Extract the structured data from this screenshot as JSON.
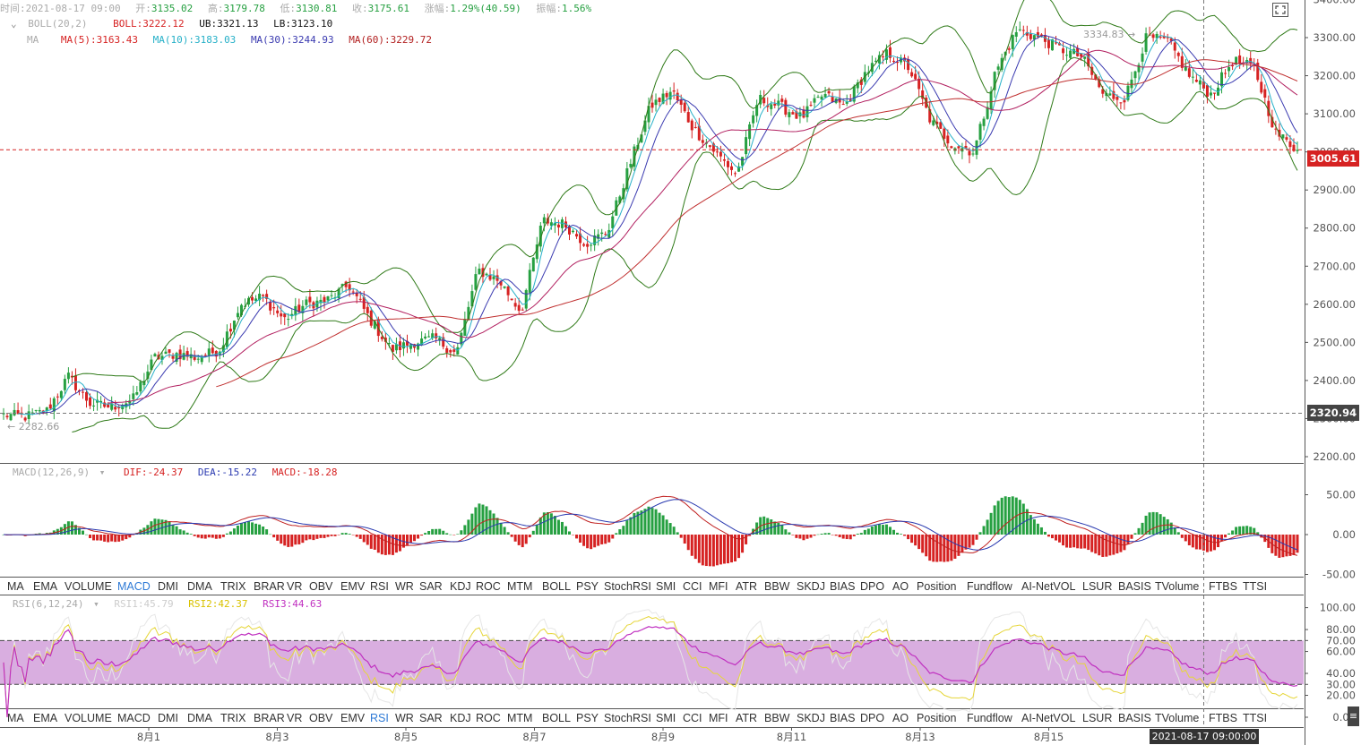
{
  "info_bar": {
    "time_label": "时间:",
    "time": "2021-08-17 09:00",
    "open_label": "开:",
    "open": "3135.02",
    "high_label": "高:",
    "high": "3179.78",
    "low_label": "低:",
    "low": "3130.81",
    "close_label": "收:",
    "close": "3175.61",
    "change_label": "涨幅:",
    "change": "1.29%(40.59)",
    "amplitude_label": "振幅:",
    "amplitude": "1.56%"
  },
  "boll_legend": {
    "name": "BOLL(20,2)",
    "boll": "BOLL:3222.12",
    "ub": "UB:3321.13",
    "lb": "LB:3123.10"
  },
  "ma_legend": {
    "name": "MA",
    "ma5": "MA(5):3163.43",
    "ma10": "MA(10):3183.03",
    "ma30": "MA(30):3244.93",
    "ma60": "MA(60):3229.72"
  },
  "macd_legend": {
    "name": "MACD(12,26,9)",
    "dif": "DIF:-24.37",
    "dea": "DEA:-15.22",
    "macd": "MACD:-18.28"
  },
  "rsi_legend": {
    "name": "RSI(6,12,24)",
    "rsi1": "RSI1:45.79",
    "rsi2": "RSI2:42.37",
    "rsi3": "RSI3:44.63"
  },
  "price_tags": {
    "current": "3005.61",
    "crosshair": "2320.94",
    "high_annot": "3334.83",
    "low_annot": "2282.66"
  },
  "crosshair_time": "2021-08-17 09:00:00",
  "indicator_tabs": [
    "MA",
    "EMA",
    "VOLUME",
    "MACD",
    "DMI",
    "DMA",
    "TRIX",
    "BRAR",
    "VR",
    "OBV",
    "EMV",
    "RSI",
    "WR",
    "SAR",
    "KDJ",
    "ROC",
    "MTM",
    "BOLL",
    "PSY",
    "StochRSI",
    "SMI",
    "CCI",
    "MFI",
    "ATR",
    "BBW",
    "SKDJ",
    "BIAS",
    "DPO",
    "AO",
    "Position",
    "Fundflow",
    "AI-NetVOL",
    "LSUR",
    "BASIS",
    "TVolume",
    "FTBS",
    "TTSI"
  ],
  "active_tab_row1": "MACD",
  "active_tab_row2": "RSI",
  "colors": {
    "up": "#26a041",
    "down": "#d62222",
    "ma5": "#26b0c8",
    "ma10": "#3a3ab0",
    "ma30": "#b22060",
    "ma60": "#c03030",
    "boll": "#2f7a18",
    "rsi_band": "#d9aee0"
  },
  "chart_data": [
    {
      "type": "candlestick",
      "title": "",
      "xlabel": "",
      "ylabel": "",
      "x_ticks": [
        "8月1",
        "8月3",
        "8月5",
        "8月7",
        "8月9",
        "8月11",
        "8月13",
        "8月15"
      ],
      "ylim": [
        2200,
        3400
      ],
      "y_ticks": [
        2200,
        2300,
        2400,
        2500,
        2600,
        2700,
        2800,
        2900,
        3000,
        3100,
        3200,
        3300,
        3400
      ],
      "y_tick_labels": [
        "2200.00",
        "2300.00",
        "2400.00",
        "2500.00",
        "2600.00",
        "2700.00",
        "2800.00",
        "2900.00",
        "3000.00",
        "3100.00",
        "3200.00",
        "3300.00",
        "3400.00"
      ],
      "close_path": [
        2310,
        2305,
        2320,
        2410,
        2340,
        2330,
        2350,
        2460,
        2470,
        2460,
        2480,
        2600,
        2620,
        2560,
        2600,
        2610,
        2650,
        2560,
        2480,
        2500,
        2510,
        2470,
        2690,
        2660,
        2580,
        2820,
        2810,
        2760,
        2790,
        2960,
        3120,
        3160,
        3060,
        3000,
        2940,
        3140,
        3120,
        3090,
        3150,
        3120,
        3210,
        3260,
        3220,
        3080,
        3020,
        3000,
        3210,
        3320,
        3300,
        3270,
        3250,
        3150,
        3140,
        3300,
        3290,
        3200,
        3150,
        3240,
        3220,
        3050,
        3005
      ],
      "series": [
        {
          "name": "BOLL",
          "values": [
            3222.12
          ]
        },
        {
          "name": "UB",
          "values": [
            3321.13
          ]
        },
        {
          "name": "LB",
          "values": [
            3123.1
          ]
        },
        {
          "name": "MA5",
          "values": [
            3163.43
          ]
        },
        {
          "name": "MA10",
          "values": [
            3183.03
          ]
        },
        {
          "name": "MA30",
          "values": [
            3244.93
          ]
        },
        {
          "name": "MA60",
          "values": [
            3229.72
          ]
        }
      ],
      "last_price": 3005.61,
      "crosshair_price": 2320.94,
      "annotations": [
        {
          "label": "3334.83"
        },
        {
          "label": "2282.66"
        }
      ],
      "grid": false
    },
    {
      "type": "bar",
      "title": "",
      "ylim": [
        -60,
        60
      ],
      "y_ticks": [
        50,
        0,
        -50
      ],
      "y_tick_labels": [
        "50.00",
        "0.00",
        "-50.00"
      ],
      "series": [
        {
          "name": "DIF",
          "values": [
            -24.37
          ]
        },
        {
          "name": "DEA",
          "values": [
            -15.22
          ]
        },
        {
          "name": "MACD",
          "values": [
            -18.28
          ]
        }
      ]
    },
    {
      "type": "line",
      "title": "",
      "ylim": [
        0,
        100
      ],
      "y_ticks": [
        100,
        80,
        70,
        60,
        40,
        30,
        20,
        0
      ],
      "y_tick_labels": [
        "100.00",
        "80.00",
        "70.00",
        "60.00",
        "40.00",
        "30.00",
        "20.00",
        "0.00"
      ],
      "band": [
        30,
        70
      ],
      "series": [
        {
          "name": "RSI1",
          "values": [
            45.79
          ]
        },
        {
          "name": "RSI2",
          "values": [
            42.37
          ]
        },
        {
          "name": "RSI3",
          "values": [
            44.63
          ]
        }
      ]
    }
  ]
}
